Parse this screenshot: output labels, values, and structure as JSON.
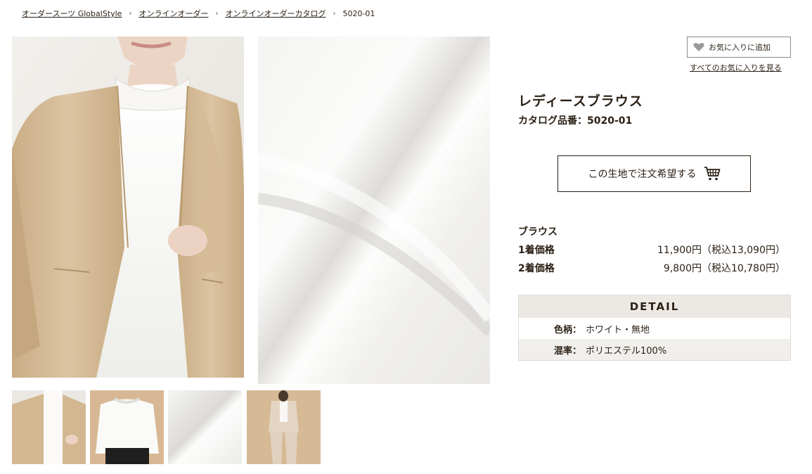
{
  "breadcrumb": {
    "items": [
      "オーダースーツ GlobalStyle",
      "オンラインオーダー",
      "オンラインオーダーカタログ"
    ],
    "separator": "›",
    "current": "5020-01"
  },
  "favorite": {
    "add_label": "お気に入りに追加",
    "view_all_label": "すべてのお気に入りを見る"
  },
  "product": {
    "name": "レディースブラウス",
    "catalog_number": "カタログ品番：5020-01"
  },
  "order": {
    "button_label": "この生地で注文希望する"
  },
  "pricing": {
    "heading": "ブラウス",
    "rows": [
      {
        "label": "1着価格",
        "value": "11,900円（税込13,090円）"
      },
      {
        "label": "2着価格",
        "value": "9,800円（税込10,780円）"
      }
    ]
  },
  "detail": {
    "header": "DETAIL",
    "rows": [
      {
        "key": "色柄：",
        "value": "ホワイト・無地"
      },
      {
        "key": "混率：",
        "value": "ポリエステル100%"
      }
    ]
  },
  "icons": {
    "favorite": "heart-icon",
    "cart": "cart-icon"
  },
  "colors": {
    "text": "#2a1f14",
    "detail_header_bg": "#ece8e3",
    "jacket": "#d8bf9c",
    "blouse": "#fbfaf8"
  }
}
